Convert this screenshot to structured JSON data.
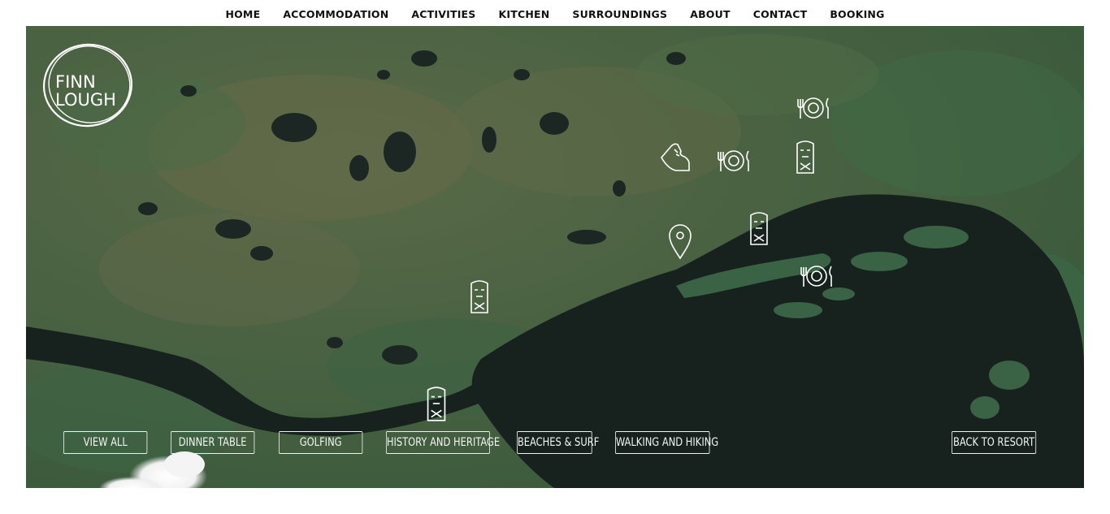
{
  "nav": {
    "items": [
      {
        "label": "HOME"
      },
      {
        "label": "ACCOMMODATION"
      },
      {
        "label": "ACTIVITIES"
      },
      {
        "label": "KITCHEN"
      },
      {
        "label": "SURROUNDINGS"
      },
      {
        "label": "ABOUT"
      },
      {
        "label": "CONTACT"
      },
      {
        "label": "BOOKING"
      }
    ]
  },
  "logo": {
    "line1": "FINN",
    "line2": "LOUGH"
  },
  "map": {
    "colors": {
      "land": "#3e5b40",
      "water": "#17221f",
      "icons": "#ffffff"
    },
    "markers": [
      "dining-icon",
      "walking-icon",
      "dining-icon",
      "heritage-icon",
      "location-pin-icon",
      "heritage-icon",
      "dining-icon",
      "heritage-icon",
      "heritage-icon"
    ]
  },
  "filters": {
    "view_all": "VIEW ALL",
    "dinner_table": "DINNER TABLE",
    "golfing": "GOLFING",
    "history": "HISTORY AND HERITAGE",
    "beaches": "BEACHES & SURF",
    "walking": "WALKING AND HIKING",
    "back": "BACK TO RESORT"
  }
}
